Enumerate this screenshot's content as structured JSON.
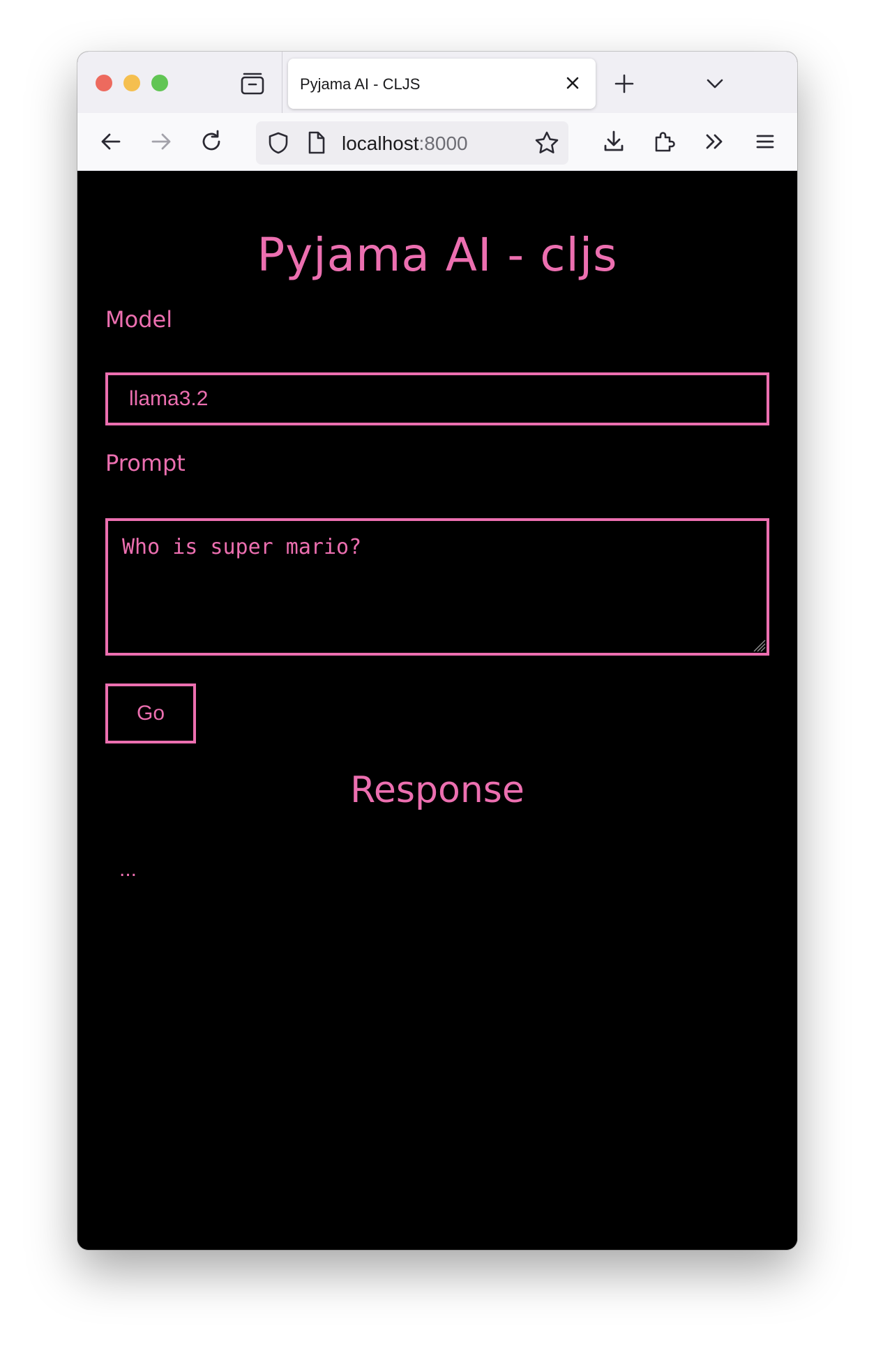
{
  "browser": {
    "tab_title": "Pyjama AI - CLJS",
    "url_host": "localhost",
    "url_port": ":8000",
    "traffic_lights": [
      "#ed6a5e",
      "#f5bf4f",
      "#61c554"
    ]
  },
  "page": {
    "title": "Pyjama AI - cljs",
    "model_label": "Model",
    "model_value": "llama3.2",
    "prompt_label": "Prompt",
    "prompt_value": "Who is super mario?",
    "go_label": "Go",
    "response_title": "Response",
    "response_text": "..."
  },
  "colors": {
    "accent": "#ec6fb0",
    "background": "#000000"
  }
}
